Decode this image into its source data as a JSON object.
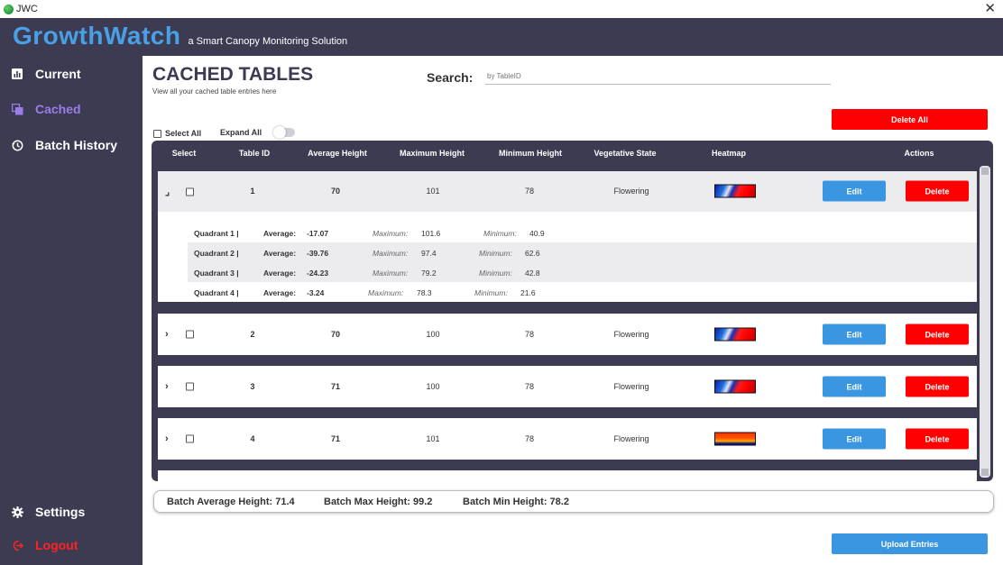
{
  "window": {
    "title": "JWC",
    "close_glyph": "✕"
  },
  "header": {
    "brand": "GrowthWatch",
    "tagline": "a Smart Canopy Monitoring Solution"
  },
  "sidebar": {
    "items": [
      {
        "label": "Current",
        "icon": "bar-chart-icon",
        "active": false
      },
      {
        "label": "Cached",
        "icon": "copy-icon",
        "active": true
      },
      {
        "label": "Batch History",
        "icon": "history-icon",
        "active": false
      }
    ],
    "settings_label": "Settings",
    "logout_label": "Logout"
  },
  "page": {
    "title": "CACHED TABLES",
    "subtitle": "View all your cached table entries here"
  },
  "search": {
    "label": "Search:",
    "placeholder": "by TableID"
  },
  "controls": {
    "delete_all": "Delete All",
    "select_all": "Select All",
    "expand_all": "Expand All",
    "expand_all_on": false
  },
  "table": {
    "columns": [
      "Select",
      "Table ID",
      "Average Height",
      "Maximum Height",
      "Minimum Height",
      "Vegetative State",
      "Heatmap",
      "Actions"
    ],
    "edit_label": "Edit",
    "delete_label": "Delete",
    "rows": [
      {
        "id": "1",
        "avg": "70",
        "max": "101",
        "min": "78",
        "state": "Flowering",
        "expanded": true,
        "expander": "⌟"
      },
      {
        "id": "2",
        "avg": "70",
        "max": "100",
        "min": "78",
        "state": "Flowering",
        "expanded": false,
        "expander": "›"
      },
      {
        "id": "3",
        "avg": "71",
        "max": "100",
        "min": "78",
        "state": "Flowering",
        "expanded": false,
        "expander": "›"
      },
      {
        "id": "4",
        "avg": "71",
        "max": "101",
        "min": "78",
        "state": "Flowering",
        "expanded": false,
        "expander": "›"
      }
    ],
    "quadrant_labels": {
      "average": "Average:",
      "maximum": "Maximum:",
      "minimum": "Minimum:"
    },
    "quadrants": [
      {
        "name": "Quadrant 1  |",
        "avg": "-17.07",
        "max": "101.6",
        "min": "40.9"
      },
      {
        "name": "Quadrant 2  |",
        "avg": "-39.76",
        "max": "97.4",
        "min": "62.6"
      },
      {
        "name": "Quadrant 3  |",
        "avg": "-24.23",
        "max": "79.2",
        "min": "42.8"
      },
      {
        "name": "Quadrant 4  |",
        "avg": "-3.24",
        "max": "78.3",
        "min": "21.6"
      }
    ]
  },
  "summary": {
    "avg": "Batch Average Height: 71.4",
    "max": "Batch Max Height: 99.2",
    "min": "Batch Min Height: 78.2"
  },
  "upload_label": "Upload Entries",
  "colors": {
    "sidebar": "#3c3b52",
    "brand": "#4aa0e6",
    "active_nav": "#9b7de8",
    "danger": "#ff0000",
    "primary": "#3a96e0"
  }
}
